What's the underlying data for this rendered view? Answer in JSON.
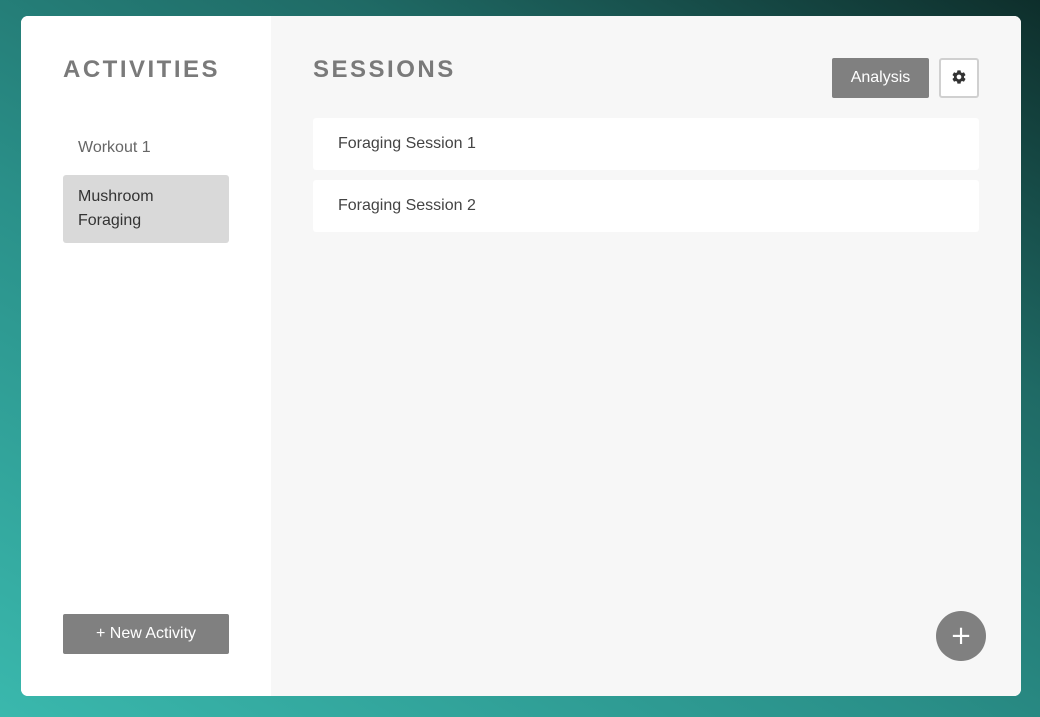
{
  "sidebar": {
    "title": "ACTIVITIES",
    "items": [
      {
        "label": "Workout 1",
        "active": false
      },
      {
        "label": "Mushroom Foraging",
        "active": true
      }
    ],
    "new_activity_label": "+ New Activity"
  },
  "main": {
    "title": "SESSIONS",
    "analysis_label": "Analysis",
    "settings_icon": "gear-icon",
    "sessions": [
      {
        "label": "Foraging Session 1"
      },
      {
        "label": "Foraging Session 2"
      }
    ],
    "add_button_label": "+"
  },
  "colors": {
    "button_gray": "#808080",
    "active_item_bg": "#d9d9d9",
    "main_bg": "#f7f7f7",
    "title_gray": "#7a7a7a"
  }
}
